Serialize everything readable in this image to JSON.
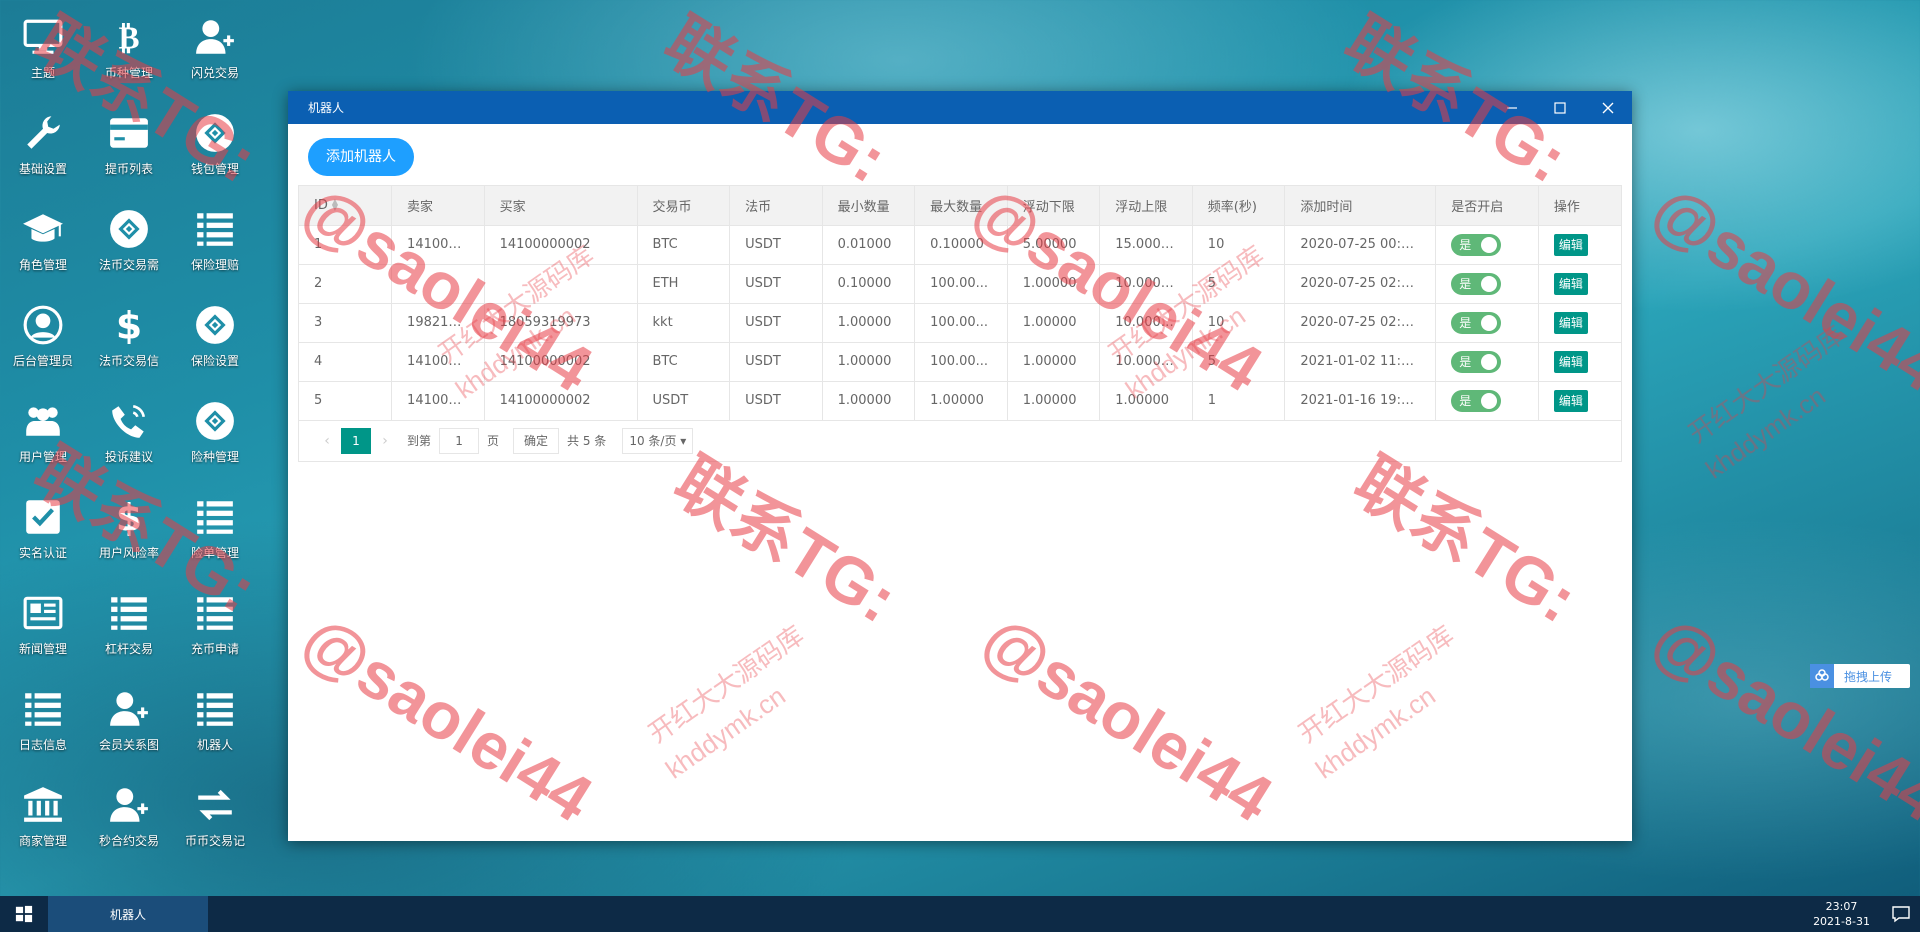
{
  "desktop": {
    "icons": [
      {
        "label": "主题",
        "icon": "monitor-icon"
      },
      {
        "label": "币种管理",
        "icon": "bitcoin-icon"
      },
      {
        "label": "闪兑交易",
        "icon": "user-add-icon"
      },
      {
        "label": "基础设置",
        "icon": "wrench-icon"
      },
      {
        "label": "提币列表",
        "icon": "card-icon"
      },
      {
        "label": "钱包管理",
        "icon": "link-icon"
      },
      {
        "label": "角色管理",
        "icon": "graduation-cap-icon"
      },
      {
        "label": "法币交易需",
        "icon": "link-icon"
      },
      {
        "label": "保险理赔",
        "icon": "list-icon"
      },
      {
        "label": "后台管理员",
        "icon": "user-circle-icon"
      },
      {
        "label": "法币交易信",
        "icon": "dollar-icon"
      },
      {
        "label": "保险设置",
        "icon": "link-icon"
      },
      {
        "label": "用户管理",
        "icon": "users-icon"
      },
      {
        "label": "投诉建议",
        "icon": "phone-icon"
      },
      {
        "label": "险种管理",
        "icon": "link-icon"
      },
      {
        "label": "实名认证",
        "icon": "check-square-icon"
      },
      {
        "label": "用户风险率",
        "icon": "dollar-icon"
      },
      {
        "label": "险单管理",
        "icon": "list-icon"
      },
      {
        "label": "新闻管理",
        "icon": "newspaper-icon"
      },
      {
        "label": "杠杆交易",
        "icon": "list-icon"
      },
      {
        "label": "充币申请",
        "icon": "list-icon"
      },
      {
        "label": "日志信息",
        "icon": "list-icon"
      },
      {
        "label": "会员关系图",
        "icon": "user-add-icon"
      },
      {
        "label": "机器人",
        "icon": "list-icon"
      },
      {
        "label": "商家管理",
        "icon": "bank-icon"
      },
      {
        "label": "秒合约交易",
        "icon": "user-add-icon"
      },
      {
        "label": "币币交易记",
        "icon": "exchange-icon"
      }
    ]
  },
  "window": {
    "title": "机器人",
    "add_button": "添加机器人",
    "columns": [
      "ID",
      "卖家",
      "买家",
      "交易币",
      "法币",
      "最小数量",
      "最大数量",
      "浮动下限",
      "浮动上限",
      "频率(秒)",
      "添加时间",
      "是否开启",
      "操作"
    ],
    "rows": [
      {
        "id": "1",
        "seller": "141000...",
        "buyer": "14100000002",
        "coin": "BTC",
        "fiat": "USDT",
        "min": "0.01000",
        "max": "0.10000",
        "float_low": "5.00000",
        "float_high": "15.00000",
        "freq": "10",
        "added": "2020-07-25 00:5...",
        "enabled": "是",
        "edit": "编辑",
        "more": "..."
      },
      {
        "id": "2",
        "seller": "",
        "buyer": "",
        "coin": "ETH",
        "fiat": "USDT",
        "min": "0.10000",
        "max": "100.00...",
        "float_low": "1.00000",
        "float_high": "10.00000",
        "freq": "5",
        "added": "2020-07-25 02:2...",
        "enabled": "是",
        "edit": "编辑",
        "more": "..."
      },
      {
        "id": "3",
        "seller": "198212...",
        "buyer": "18059319973",
        "coin": "kkt",
        "fiat": "USDT",
        "min": "1.00000",
        "max": "100.00...",
        "float_low": "1.00000",
        "float_high": "10.00000",
        "freq": "10",
        "added": "2020-07-25 02:4...",
        "enabled": "是",
        "edit": "编辑",
        "more": "..."
      },
      {
        "id": "4",
        "seller": "141000...",
        "buyer": "14100000002",
        "coin": "BTC",
        "fiat": "USDT",
        "min": "1.00000",
        "max": "100.00...",
        "float_low": "1.00000",
        "float_high": "10.00000",
        "freq": "5",
        "added": "2021-01-02 11:3...",
        "enabled": "是",
        "edit": "编辑",
        "more": "..."
      },
      {
        "id": "5",
        "seller": "141000...",
        "buyer": "14100000002",
        "coin": "USDT",
        "fiat": "USDT",
        "min": "1.00000",
        "max": "1.00000",
        "float_low": "1.00000",
        "float_high": "1.00000",
        "freq": "1",
        "added": "2021-01-16 19:5...",
        "enabled": "是",
        "edit": "编辑",
        "more": "..."
      }
    ],
    "pager": {
      "prev": "‹",
      "current": "1",
      "next": "›",
      "goto_label": "到第",
      "goto_value": "1",
      "page_label": "页",
      "confirm": "确定",
      "total": "共 5 条",
      "per_page": "10 条/页"
    }
  },
  "upload_widget": {
    "label": "拖拽上传"
  },
  "taskbar": {
    "task": "机器人",
    "time": "23:07",
    "date": "2021-8-31"
  },
  "watermarks": {
    "contact": "联系TG:",
    "handle": "@saolei44",
    "site_cn": "开红大大源码库",
    "site_url": "khddymk.cn"
  },
  "colors": {
    "titlebar": "#0b5fb2",
    "primary_button": "#1e9fff",
    "teal": "#009688",
    "switch_on": "#5fb878",
    "taskbar": "#0d2a46",
    "watermark": "#e83c46"
  }
}
